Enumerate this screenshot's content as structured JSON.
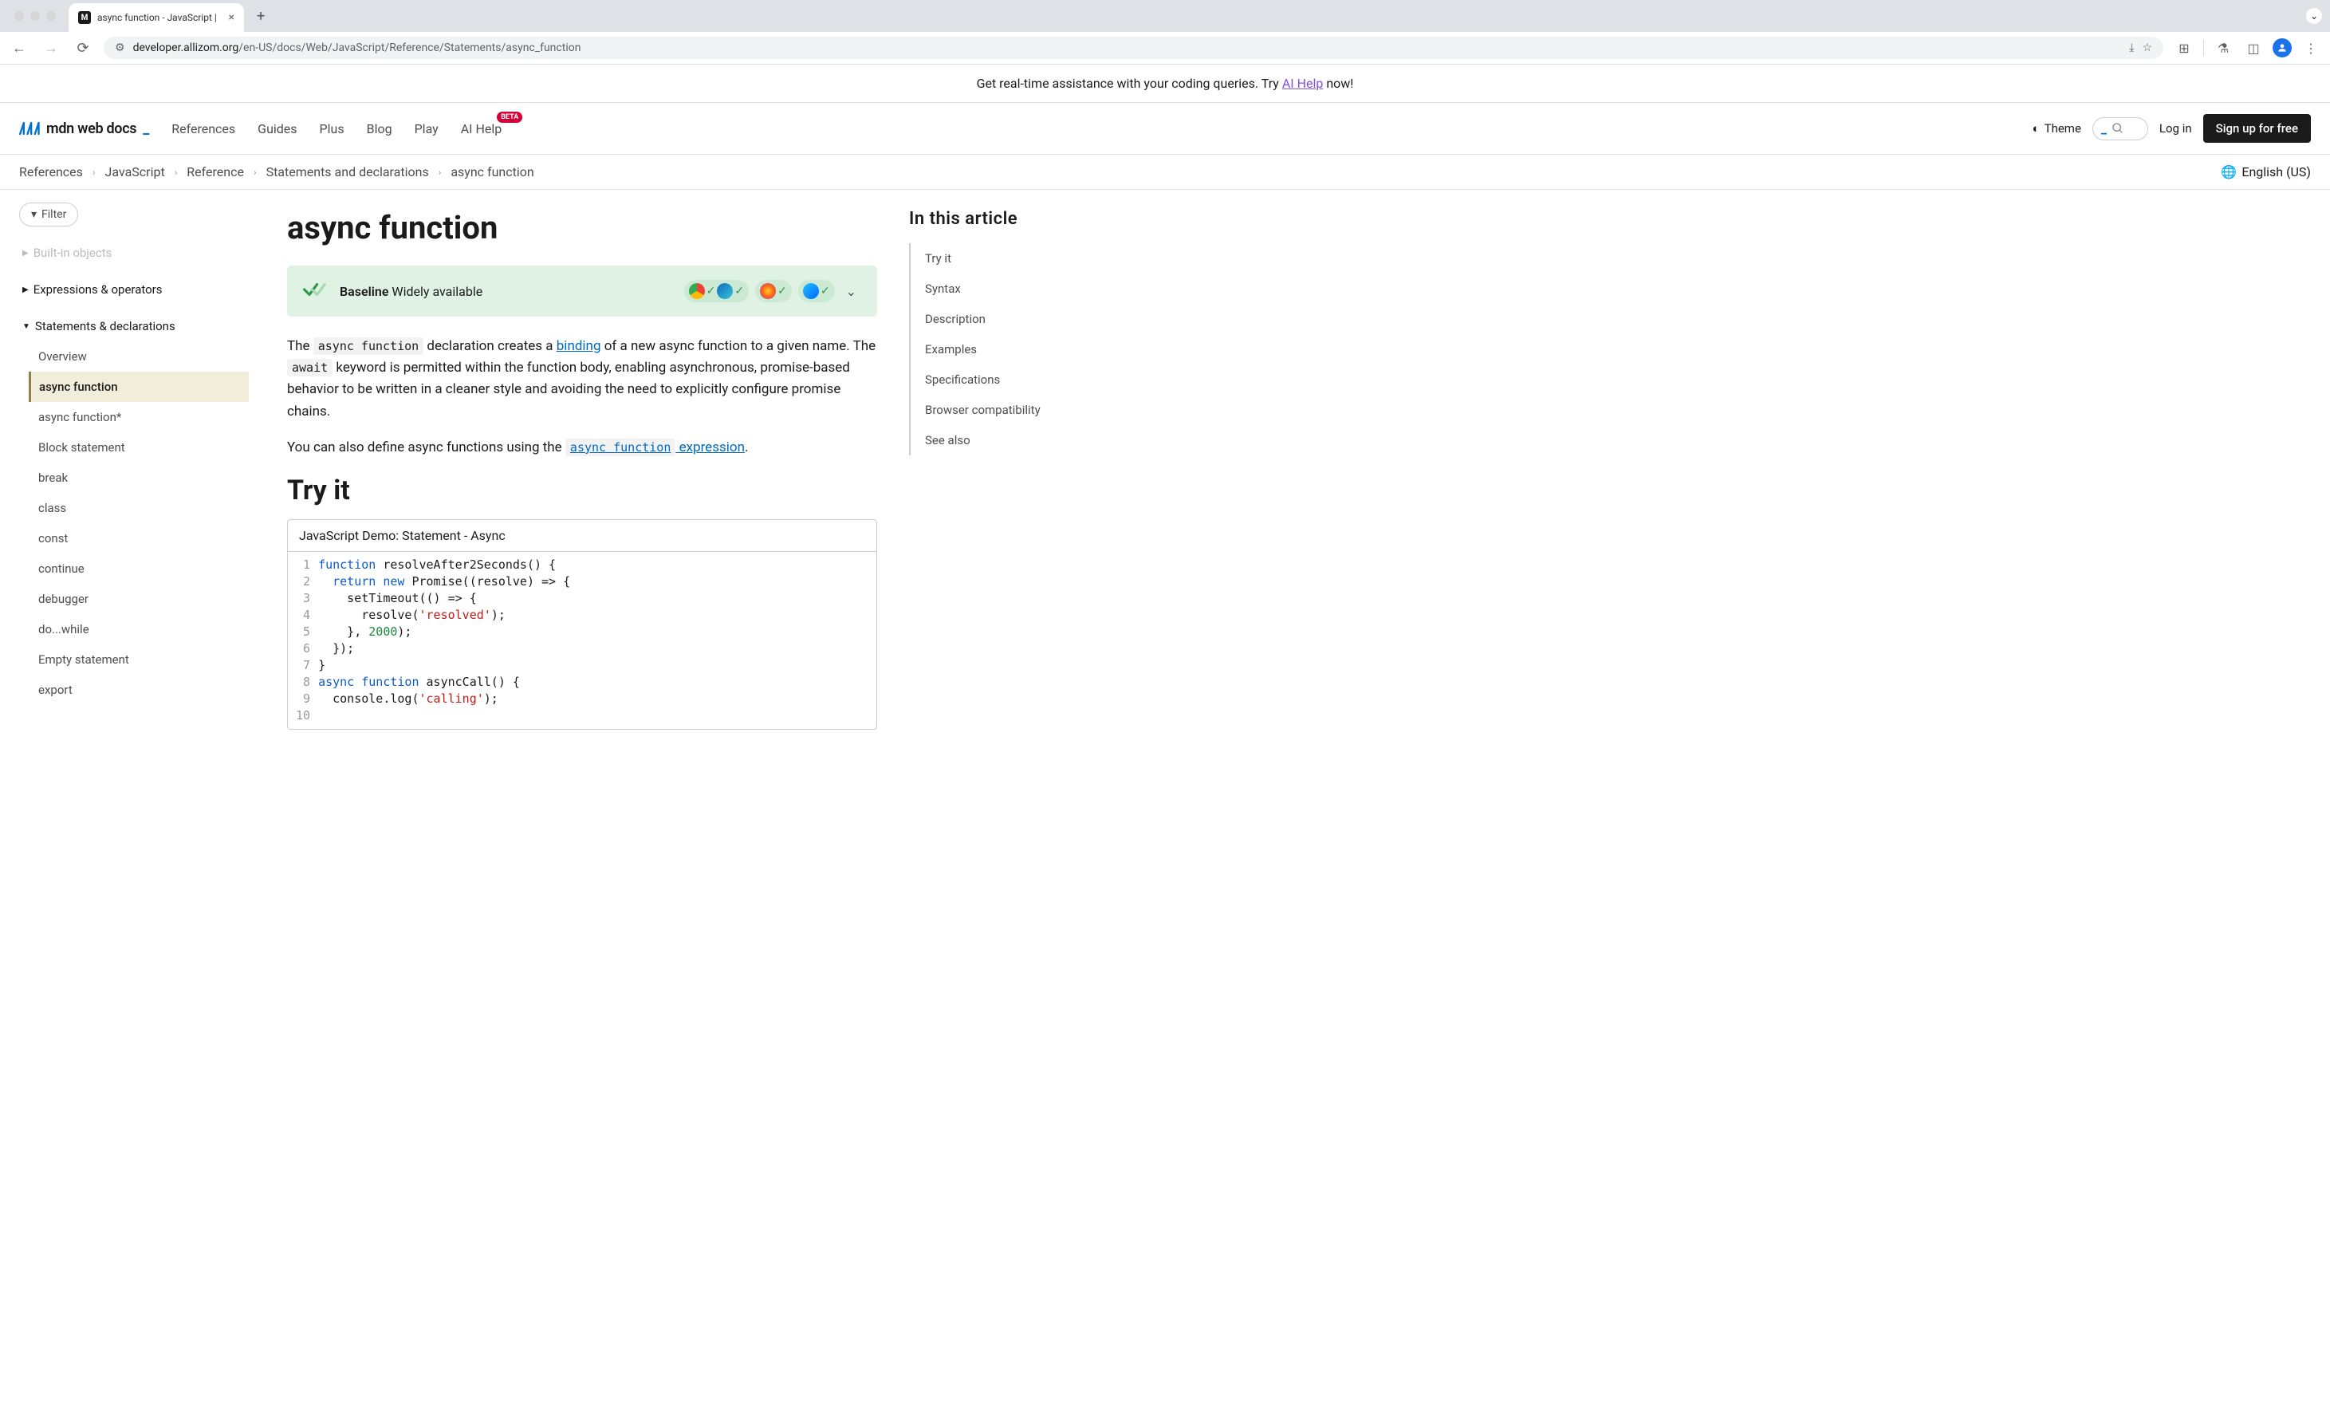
{
  "browser": {
    "tab_title": "async function - JavaScript |",
    "url_host": "developer.allizom.org",
    "url_path": "/en-US/docs/Web/JavaScript/Reference/Statements/async_function"
  },
  "announce": {
    "prefix": "Get real-time assistance with your coding queries. Try ",
    "link": "AI Help",
    "suffix": " now!"
  },
  "header": {
    "logo_text": "mdn web docs",
    "nav": [
      "References",
      "Guides",
      "Plus",
      "Blog",
      "Play",
      "AI Help"
    ],
    "beta_on": "AI Help",
    "theme_label": "Theme",
    "login": "Log in",
    "signup": "Sign up for free"
  },
  "breadcrumb": [
    "References",
    "JavaScript",
    "Reference",
    "Statements and declarations",
    "async function"
  ],
  "language": "English (US)",
  "sidebar_left": {
    "filter_label": "Filter",
    "faded_group": "Built-in objects",
    "groups": [
      {
        "label": "Expressions & operators",
        "expanded": false
      },
      {
        "label": "Statements & declarations",
        "expanded": true,
        "items": [
          "Overview",
          "async function",
          "async function*",
          "Block statement",
          "break",
          "class",
          "const",
          "continue",
          "debugger",
          "do...while",
          "Empty statement",
          "export"
        ],
        "active": "async function"
      }
    ]
  },
  "article": {
    "title": "async function",
    "baseline_strong": "Baseline",
    "baseline_rest": " Widely available",
    "p1_pre": "The ",
    "p1_code1": "async function",
    "p1_mid1": " declaration creates a ",
    "p1_link1": "binding",
    "p1_mid2": " of a new async function to a given name. The ",
    "p1_code2": "await",
    "p1_post": " keyword is permitted within the function body, enabling asynchronous, promise-based behavior to be written in a cleaner style and avoiding the need to explicitly configure promise chains.",
    "p2_pre": "You can also define async functions using the ",
    "p2_linkcode": "async function",
    "p2_linktext": " expression",
    "p2_post": ".",
    "h2_tryit": "Try it",
    "demo_title": "JavaScript Demo: Statement - Async",
    "code_lines": [
      [
        {
          "t": "function",
          "c": "kw"
        },
        {
          "t": " resolveAfter2Seconds() {"
        }
      ],
      [
        {
          "t": "  "
        },
        {
          "t": "return",
          "c": "kw"
        },
        {
          "t": " "
        },
        {
          "t": "new",
          "c": "kw"
        },
        {
          "t": " Promise((resolve) => {"
        }
      ],
      [
        {
          "t": "    setTimeout(() => {"
        }
      ],
      [
        {
          "t": "      resolve("
        },
        {
          "t": "'resolved'",
          "c": "str"
        },
        {
          "t": ");"
        }
      ],
      [
        {
          "t": "    }, "
        },
        {
          "t": "2000",
          "c": "num"
        },
        {
          "t": ");"
        }
      ],
      [
        {
          "t": "  });"
        }
      ],
      [
        {
          "t": "}"
        }
      ],
      [
        {
          "t": ""
        }
      ],
      [
        {
          "t": "async",
          "c": "kw"
        },
        {
          "t": " "
        },
        {
          "t": "function",
          "c": "kw"
        },
        {
          "t": " asyncCall() {"
        }
      ],
      [
        {
          "t": "  console.log("
        },
        {
          "t": "'calling'",
          "c": "str"
        },
        {
          "t": ");"
        }
      ]
    ]
  },
  "toc": {
    "heading": "In this article",
    "items": [
      "Try it",
      "Syntax",
      "Description",
      "Examples",
      "Specifications",
      "Browser compatibility",
      "See also"
    ]
  }
}
